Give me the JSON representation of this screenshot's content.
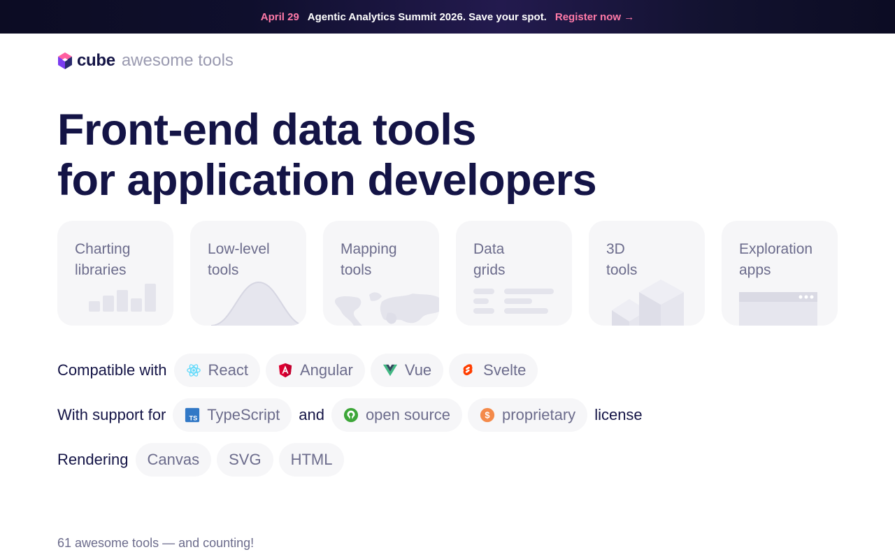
{
  "banner": {
    "date": "April 29",
    "message": "Agentic Analytics Summit 2026. Save your spot.",
    "cta": "Register now →"
  },
  "logo": {
    "brand": "cube",
    "subtitle": "awesome tools"
  },
  "hero": {
    "line1": "Front-end data tools",
    "line2": "for application developers"
  },
  "categories": [
    {
      "label": "Charting\nlibraries",
      "icon": "bar-chart-icon"
    },
    {
      "label": "Low-level\ntools",
      "icon": "curve-icon"
    },
    {
      "label": "Mapping\ntools",
      "icon": "world-map-icon"
    },
    {
      "label": "Data\ngrids",
      "icon": "grid-lines-icon"
    },
    {
      "label": "3D\ntools",
      "icon": "cubes-icon"
    },
    {
      "label": "Exploration\napps",
      "icon": "browser-window-icon"
    }
  ],
  "compatible": {
    "lead": "Compatible with",
    "items": [
      {
        "label": "React",
        "icon": "react-icon"
      },
      {
        "label": "Angular",
        "icon": "angular-icon"
      },
      {
        "label": "Vue",
        "icon": "vue-icon"
      },
      {
        "label": "Svelte",
        "icon": "svelte-icon"
      }
    ]
  },
  "support": {
    "lead": "With support for",
    "typescript": "TypeScript",
    "and": "and",
    "open_source": "open source",
    "proprietary": "proprietary",
    "license": "license"
  },
  "rendering": {
    "lead": "Rendering",
    "items": [
      "Canvas",
      "SVG",
      "HTML"
    ]
  },
  "footer": {
    "count_text": "61 awesome tools — and counting!"
  },
  "colors": {
    "navy": "#141446",
    "muted": "#6c6c8c",
    "pink": "#ff7aa8",
    "pill_bg": "#f6f6f8",
    "react": "#61dafb",
    "angular": "#dd0031",
    "vue": "#41b883",
    "svelte": "#ff3e00",
    "typescript": "#3178c6",
    "open_source": "#3da639",
    "proprietary": "#f48a4a"
  }
}
